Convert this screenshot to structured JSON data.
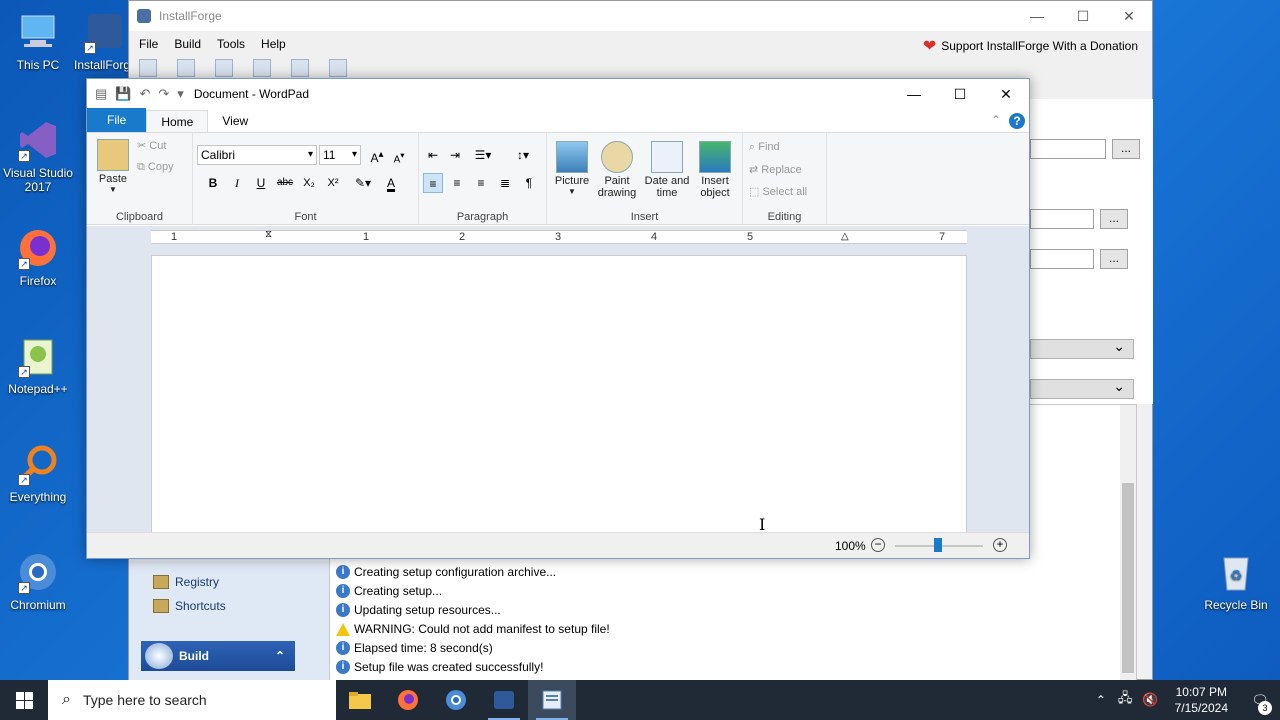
{
  "desktop": {
    "icons": [
      {
        "label": "This PC"
      },
      {
        "label": "InstallForge"
      },
      {
        "label": "Visual Studio 2017"
      },
      {
        "label": "Firefox"
      },
      {
        "label": "Notepad++"
      },
      {
        "label": "Everything"
      },
      {
        "label": "Chromium"
      },
      {
        "label": "Recycle Bin"
      }
    ]
  },
  "installforge": {
    "title": "InstallForge",
    "menu": [
      "File",
      "Build",
      "Tools",
      "Help"
    ],
    "donate": "Support InstallForge With a Donation",
    "dots": "...",
    "nav": {
      "registry": "Registry",
      "shortcuts": "Shortcuts",
      "build": "Build"
    },
    "log": [
      {
        "type": "info",
        "text": "Creating setup configuration archive..."
      },
      {
        "type": "info",
        "text": "Creating setup..."
      },
      {
        "type": "info",
        "text": "Updating setup resources..."
      },
      {
        "type": "warning",
        "text": "WARNING: Could not add manifest to setup file!"
      },
      {
        "type": "info",
        "text": "Elapsed time: 8 second(s)"
      },
      {
        "type": "info",
        "text": "Setup file was created successfully!"
      }
    ]
  },
  "wordpad": {
    "title": "Document - WordPad",
    "tabs": {
      "file": "File",
      "home": "Home",
      "view": "View"
    },
    "help": "?",
    "clipboard": {
      "paste": "Paste",
      "cut": "Cut",
      "copy": "Copy",
      "label": "Clipboard"
    },
    "font": {
      "family": "Calibri",
      "size": "11",
      "label": "Font",
      "bold": "B",
      "italic": "I",
      "underline": "U",
      "strike": "abc",
      "sub": "X₂",
      "sup": "X²",
      "color": "A"
    },
    "paragraph": {
      "label": "Paragraph"
    },
    "insert": {
      "picture": "Picture",
      "paint1": "Paint",
      "paint2": "drawing",
      "date1": "Date and",
      "date2": "time",
      "obj1": "Insert",
      "obj2": "object",
      "label": "Insert"
    },
    "editing": {
      "find": "Find",
      "replace": "Replace",
      "selectall": "Select all",
      "label": "Editing"
    },
    "ruler": [
      "1",
      "1",
      "2",
      "3",
      "4",
      "5",
      "6",
      "7"
    ],
    "zoom": "100%"
  },
  "taskbar": {
    "search_placeholder": "Type here to search",
    "time": "10:07 PM",
    "date": "7/15/2024",
    "notifications": "3"
  },
  "colors": {
    "accent": "#1979ca",
    "desktop": "#1a78d8",
    "taskbar": "#1f2a36"
  }
}
